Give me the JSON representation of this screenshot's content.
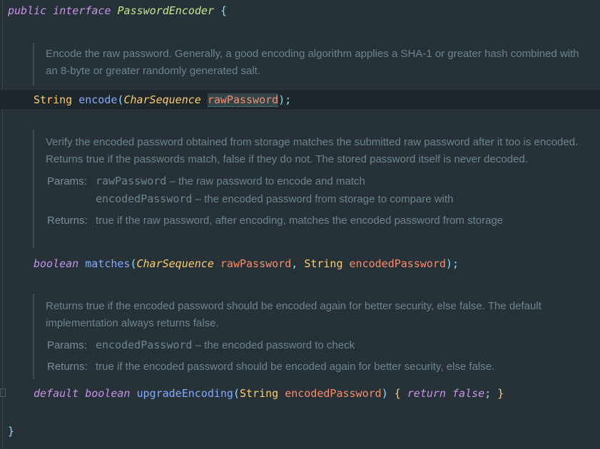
{
  "code": {
    "line1": {
      "kw1": "public",
      "kw2": "interface",
      "name": "PasswordEncoder",
      "brace": "{"
    },
    "encode": {
      "ret": "String",
      "fn": "encode",
      "open": "(",
      "ptype": "CharSequence",
      "pname": "rawPassword",
      "close": ");"
    },
    "matches": {
      "ret": "boolean",
      "fn": "matches",
      "open": "(",
      "ptype1": "CharSequence",
      "pname1": "rawPassword",
      "comma": ",",
      "ptype2": "String",
      "pname2": "encodedPassword",
      "close": ");"
    },
    "upgrade": {
      "kw": "default",
      "ret": "boolean",
      "fn": "upgradeEncoding",
      "open": "(",
      "ptype": "String",
      "pname": "encodedPassword",
      "close": ")",
      "brace_open": "{",
      "ret_kw": "return",
      "val": "false",
      "semi": ";",
      "brace_close": "}"
    },
    "closing_brace": "}"
  },
  "docs": {
    "encode": {
      "text": "Encode the raw password. Generally, a good encoding algorithm applies a SHA-1 or greater hash combined with an 8-byte or greater randomly generated salt."
    },
    "matches": {
      "text": "Verify the encoded password obtained from storage matches the submitted raw password after it too is encoded. Returns true if the passwords match, false if they do not. The stored password itself is never decoded.",
      "params_label": "Params:",
      "param1_name": "rawPassword",
      "param1_desc": " – the raw password to encode and match",
      "param2_name": "encodedPassword",
      "param2_desc": " – the encoded password from storage to compare with",
      "returns_label": "Returns:",
      "returns_text": "true if the raw password, after encoding, matches the encoded password from storage"
    },
    "upgrade": {
      "text": "Returns true if the encoded password should be encoded again for better security, else false. The default implementation always returns false.",
      "params_label": "Params:",
      "param1_name": "encodedPassword",
      "param1_desc": " – the encoded password to check",
      "returns_label": "Returns:",
      "returns_text": "true if the encoded password should be encoded again for better security, else false."
    }
  }
}
